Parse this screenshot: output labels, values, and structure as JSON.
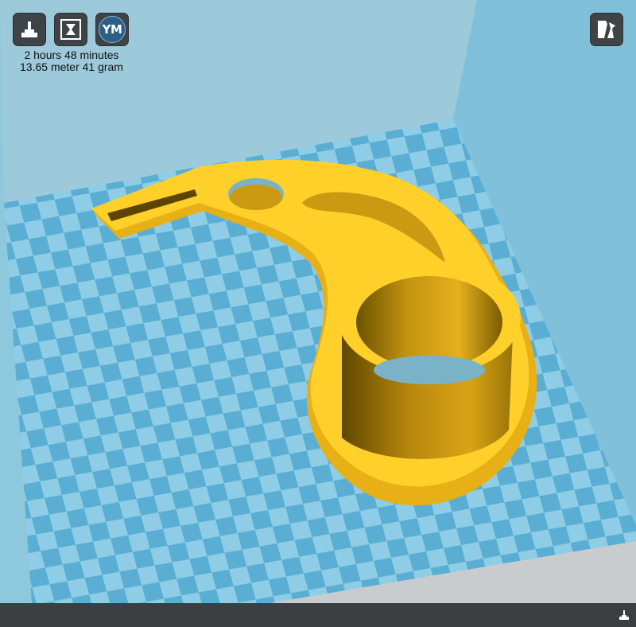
{
  "toolbar": {
    "buttons": [
      {
        "name": "load-model-button",
        "icon": "load-model-icon"
      },
      {
        "name": "print-button",
        "icon": "hourglass-print-icon"
      },
      {
        "name": "youmagine-button",
        "icon": "youmagine-icon",
        "label": "YM"
      }
    ]
  },
  "print_info": {
    "time": "2 hours 48 minutes",
    "material": "13.65 meter 41 gram"
  },
  "view_mode": {
    "icon": "view-mode-icon"
  },
  "status_bar": {
    "icon": "tray-icon"
  },
  "colors": {
    "wall_left": "#98c9dc",
    "wall_right": "#7fbfda",
    "floor_light": "#8ccbe5",
    "floor_dark": "#5aaed3",
    "model": "#ffd02a",
    "model_shadow": "#e0ac16",
    "status_bar": "#3b3f42"
  }
}
